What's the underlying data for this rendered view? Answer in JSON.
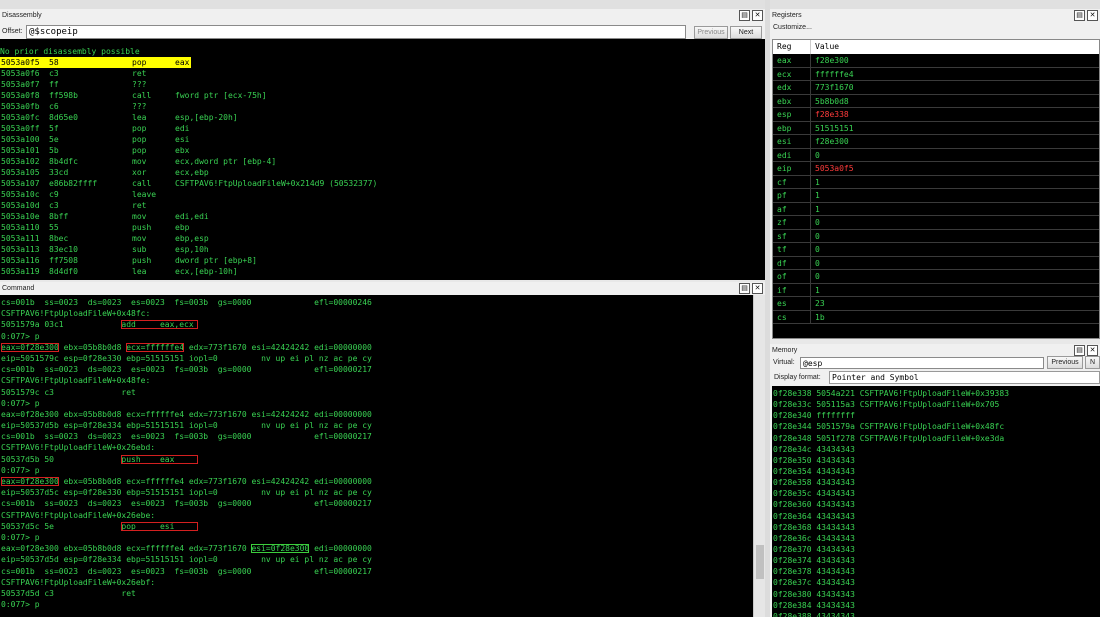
{
  "disassembly": {
    "title": "Disassembly",
    "offset_label": "Offset:",
    "offset_value": "@$scopeip",
    "previous_label": "Previous",
    "next_label": "Next",
    "prior_line": "No prior disassembly possible",
    "lines": [
      {
        "addr": "5053a0f5",
        "bytes": "58",
        "mn": "pop",
        "op": "eax"
      },
      {
        "addr": "5053a0f6",
        "bytes": "c3",
        "mn": "ret",
        "op": ""
      },
      {
        "addr": "5053a0f7",
        "bytes": "ff",
        "mn": "???",
        "op": ""
      },
      {
        "addr": "5053a0f8",
        "bytes": "ff598b",
        "mn": "call",
        "op": "fword ptr [ecx-75h]"
      },
      {
        "addr": "5053a0fb",
        "bytes": "c6",
        "mn": "???",
        "op": ""
      },
      {
        "addr": "5053a0fc",
        "bytes": "8d65e0",
        "mn": "lea",
        "op": "esp,[ebp-20h]"
      },
      {
        "addr": "5053a0ff",
        "bytes": "5f",
        "mn": "pop",
        "op": "edi"
      },
      {
        "addr": "5053a100",
        "bytes": "5e",
        "mn": "pop",
        "op": "esi"
      },
      {
        "addr": "5053a101",
        "bytes": "5b",
        "mn": "pop",
        "op": "ebx"
      },
      {
        "addr": "5053a102",
        "bytes": "8b4dfc",
        "mn": "mov",
        "op": "ecx,dword ptr [ebp-4]"
      },
      {
        "addr": "5053a105",
        "bytes": "33cd",
        "mn": "xor",
        "op": "ecx,ebp"
      },
      {
        "addr": "5053a107",
        "bytes": "e86b82ffff",
        "mn": "call",
        "op": "CSFTPAV6!FtpUploadFileW+0x214d9 (50532377)"
      },
      {
        "addr": "5053a10c",
        "bytes": "c9",
        "mn": "leave",
        "op": ""
      },
      {
        "addr": "5053a10d",
        "bytes": "c3",
        "mn": "ret",
        "op": ""
      },
      {
        "addr": "5053a10e",
        "bytes": "8bff",
        "mn": "mov",
        "op": "edi,edi"
      },
      {
        "addr": "5053a110",
        "bytes": "55",
        "mn": "push",
        "op": "ebp"
      },
      {
        "addr": "5053a111",
        "bytes": "8bec",
        "mn": "mov",
        "op": "ebp,esp"
      },
      {
        "addr": "5053a113",
        "bytes": "83ec10",
        "mn": "sub",
        "op": "esp,10h"
      },
      {
        "addr": "5053a116",
        "bytes": "ff7508",
        "mn": "push",
        "op": "dword ptr [ebp+8]"
      },
      {
        "addr": "5053a119",
        "bytes": "8d4df0",
        "mn": "lea",
        "op": "ecx,[ebp-10h]"
      }
    ]
  },
  "command": {
    "title": "Command",
    "lines": [
      {
        "t": "cs=001b  ss=0023  ds=0023  es=0023  fs=003b  gs=0000             efl=00000246"
      },
      {
        "t": "CSFTPAV6!FtpUploadFileW+0x48fc:"
      },
      {
        "t": "5051579a 03c1            ",
        "box": "add     eax,ecx ",
        "bc": "red"
      },
      {
        "t": "0:077> p"
      },
      {
        "pre": "",
        "box": "eax=0f28e300",
        "bc": "red",
        "mid": " ebx=05b8b0d8 ",
        "box2": "ecx=ffffffe4",
        "bc2": "red",
        "post": " edx=773f1670 esi=42424242 edi=00000000"
      },
      {
        "t": "eip=5051579c esp=0f28e330 ebp=51515151 iopl=0         nv up ei pl nz ac pe cy"
      },
      {
        "t": "cs=001b  ss=0023  ds=0023  es=0023  fs=003b  gs=0000             efl=00000217"
      },
      {
        "t": "CSFTPAV6!FtpUploadFileW+0x48fe:"
      },
      {
        "t": "5051579c c3              ret"
      },
      {
        "t": "0:077> p"
      },
      {
        "t": "eax=0f28e300 ebx=05b8b0d8 ecx=ffffffe4 edx=773f1670 esi=42424242 edi=00000000"
      },
      {
        "t": "eip=50537d5b esp=0f28e334 ebp=51515151 iopl=0         nv up ei pl nz ac pe cy"
      },
      {
        "t": "cs=001b  ss=0023  ds=0023  es=0023  fs=003b  gs=0000             efl=00000217"
      },
      {
        "t": "CSFTPAV6!FtpUploadFileW+0x26ebd:"
      },
      {
        "t": "50537d5b 50              ",
        "box": "push    eax     ",
        "bc": "red"
      },
      {
        "t": "0:077> p"
      },
      {
        "pre": "",
        "box": "eax=0f28e300",
        "bc": "red",
        "post": " ebx=05b8b0d8 ecx=ffffffe4 edx=773f1670 esi=42424242 edi=00000000"
      },
      {
        "t": "eip=50537d5c esp=0f28e330 ebp=51515151 iopl=0         nv up ei pl nz ac pe cy"
      },
      {
        "t": "cs=001b  ss=0023  ds=0023  es=0023  fs=003b  gs=0000             efl=00000217"
      },
      {
        "t": "CSFTPAV6!FtpUploadFileW+0x26ebe:"
      },
      {
        "t": "50537d5c 5e              ",
        "box": "pop     esi     ",
        "bc": "red"
      },
      {
        "t": "0:077> p"
      },
      {
        "pre": "eax=0f28e300 ebx=05b8b0d8 ecx=ffffffe4 edx=773f1670 ",
        "box": "esi=0f28e300",
        "bc": "green",
        "post": " edi=00000000"
      },
      {
        "t": "eip=50537d5d esp=0f28e334 ebp=51515151 iopl=0         nv up ei pl nz ac pe cy"
      },
      {
        "t": "cs=001b  ss=0023  ds=0023  es=0023  fs=003b  gs=0000             efl=00000217"
      },
      {
        "t": "CSFTPAV6!FtpUploadFileW+0x26ebf:"
      },
      {
        "t": "50537d5d c3              ret"
      },
      {
        "t": "0:077> p"
      }
    ]
  },
  "registers": {
    "title": "Registers",
    "customize_label": "Customize...",
    "col_reg": "Reg",
    "col_value": "Value",
    "rows": [
      {
        "r": "eax",
        "v": "f28e300",
        "changed": false
      },
      {
        "r": "ecx",
        "v": "ffffffe4",
        "changed": false
      },
      {
        "r": "edx",
        "v": "773f1670",
        "changed": false
      },
      {
        "r": "ebx",
        "v": "5b8b0d8",
        "changed": false
      },
      {
        "r": "esp",
        "v": "f28e338",
        "changed": true
      },
      {
        "r": "ebp",
        "v": "51515151",
        "changed": false
      },
      {
        "r": "esi",
        "v": "f28e300",
        "changed": false
      },
      {
        "r": "edi",
        "v": "0",
        "changed": false
      },
      {
        "r": "eip",
        "v": "5053a0f5",
        "changed": true
      },
      {
        "r": "cf",
        "v": "1",
        "changed": false
      },
      {
        "r": "pf",
        "v": "1",
        "changed": false
      },
      {
        "r": "af",
        "v": "1",
        "changed": false
      },
      {
        "r": "zf",
        "v": "0",
        "changed": false
      },
      {
        "r": "sf",
        "v": "0",
        "changed": false
      },
      {
        "r": "tf",
        "v": "0",
        "changed": false
      },
      {
        "r": "df",
        "v": "0",
        "changed": false
      },
      {
        "r": "of",
        "v": "0",
        "changed": false
      },
      {
        "r": "if",
        "v": "1",
        "changed": false
      },
      {
        "r": "es",
        "v": "23",
        "changed": false
      },
      {
        "r": "cs",
        "v": "1b",
        "changed": false
      }
    ]
  },
  "memory": {
    "title": "Memory",
    "virtual_label": "Virtual:",
    "virtual_value": "@esp",
    "previous_label": "Previous",
    "next_label": "N",
    "display_format_label": "Display format:",
    "display_format_value": "Pointer and Symbol",
    "lines": [
      "0f28e338 5054a221 CSFTPAV6!FtpUploadFileW+0x39383",
      "0f28e33c 505115a3 CSFTPAV6!FtpUploadFileW+0x705",
      "0f28e340 ffffffff",
      "0f28e344 5051579a CSFTPAV6!FtpUploadFileW+0x48fc",
      "0f28e348 5051f278 CSFTPAV6!FtpUploadFileW+0xe3da",
      "0f28e34c 43434343",
      "0f28e350 43434343",
      "0f28e354 43434343",
      "0f28e358 43434343",
      "0f28e35c 43434343",
      "0f28e360 43434343",
      "0f28e364 43434343",
      "0f28e368 43434343",
      "0f28e36c 43434343",
      "0f28e370 43434343",
      "0f28e374 43434343",
      "0f28e378 43434343",
      "0f28e37c 43434343",
      "0f28e380 43434343",
      "0f28e384 43434343",
      "0f28e388 43434343"
    ]
  },
  "colors": {
    "text_green": "#39d353",
    "highlight": "#ffff00",
    "changed_red": "#ff3b3b",
    "box_red": "#d42020",
    "box_green": "#3ccf3c"
  }
}
